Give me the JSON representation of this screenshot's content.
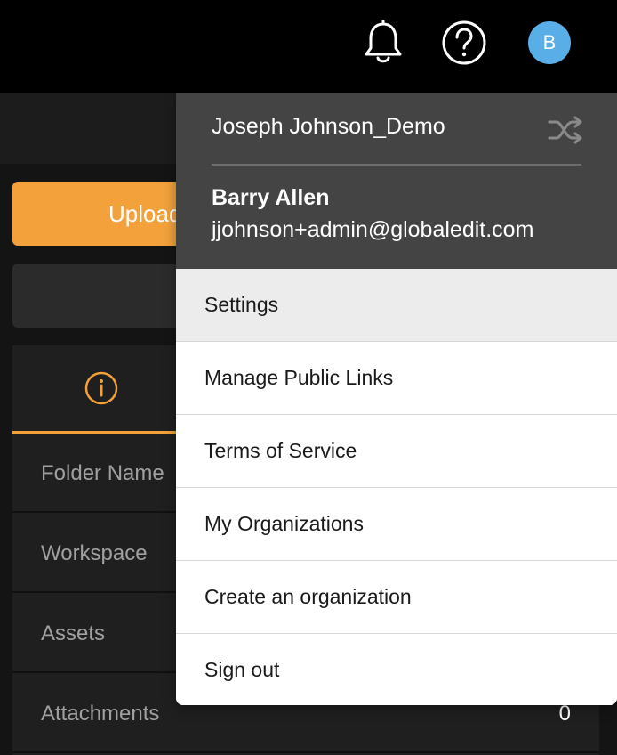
{
  "topbar": {
    "icons": [
      "bell-icon",
      "help-icon"
    ],
    "avatar_initial": "B",
    "avatar_color": "#5aaee8"
  },
  "sidebar": {
    "upload_label": "Upload",
    "accent_color": "#f3a23b"
  },
  "details": {
    "tab_icon": "info-icon",
    "rows": [
      {
        "label": "Folder Name",
        "value": ""
      },
      {
        "label": "Workspace",
        "value": ""
      },
      {
        "label": "Assets",
        "value": ""
      },
      {
        "label": "Attachments",
        "value": "0"
      }
    ]
  },
  "user_menu": {
    "organization": "Joseph Johnson_Demo",
    "switch_icon": "shuffle-icon",
    "user_name": "Barry Allen",
    "user_email": "jjohnson+admin@globaledit.com",
    "items": [
      {
        "label": "Settings"
      },
      {
        "label": "Manage Public Links"
      },
      {
        "label": "Terms of Service"
      },
      {
        "label": "My Organizations"
      },
      {
        "label": "Create an organization"
      },
      {
        "label": "Sign out"
      }
    ]
  }
}
